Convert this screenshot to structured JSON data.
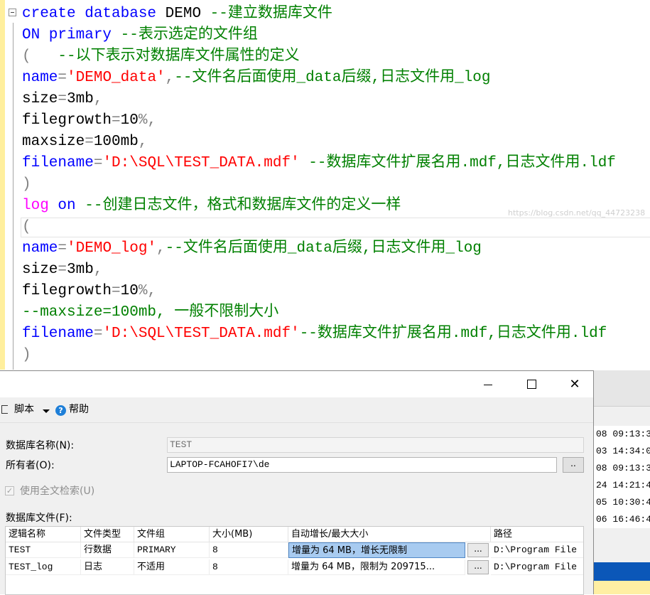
{
  "editor": {
    "lines": [
      [
        {
          "t": "create database ",
          "c": "kw"
        },
        {
          "t": "DEMO ",
          "c": "pl"
        },
        {
          "t": "--建立数据库文件",
          "c": "cm"
        }
      ],
      [
        {
          "t": "ON primary ",
          "c": "kw"
        },
        {
          "t": "--表示选定的文件组",
          "c": "cm"
        }
      ],
      [
        {
          "t": "(   ",
          "c": "op"
        },
        {
          "t": "--以下表示对数据库文件属性的定义",
          "c": "cm"
        }
      ],
      [
        {
          "t": "name",
          "c": "kw"
        },
        {
          "t": "=",
          "c": "op"
        },
        {
          "t": "'DEMO_data'",
          "c": "str"
        },
        {
          "t": ",",
          "c": "op"
        },
        {
          "t": "--文件名后面使用_data后缀,日志文件用_log",
          "c": "cm"
        }
      ],
      [
        {
          "t": "size",
          "c": "pl"
        },
        {
          "t": "=",
          "c": "op"
        },
        {
          "t": "3mb",
          "c": "pl"
        },
        {
          "t": ",",
          "c": "op"
        }
      ],
      [
        {
          "t": "filegrowth",
          "c": "pl"
        },
        {
          "t": "=",
          "c": "op"
        },
        {
          "t": "10",
          "c": "pl"
        },
        {
          "t": "%,",
          "c": "op"
        }
      ],
      [
        {
          "t": "maxsize",
          "c": "pl"
        },
        {
          "t": "=",
          "c": "op"
        },
        {
          "t": "100mb",
          "c": "pl"
        },
        {
          "t": ",",
          "c": "op"
        }
      ],
      [
        {
          "t": "filename",
          "c": "kw"
        },
        {
          "t": "=",
          "c": "op"
        },
        {
          "t": "'D:\\SQL\\TEST_DATA.mdf'",
          "c": "str"
        },
        {
          "t": " --数据库文件扩展名用.mdf,日志文件用.ldf",
          "c": "cm"
        }
      ],
      [
        {
          "t": ")",
          "c": "op"
        }
      ],
      [
        {
          "t": "log",
          "c": "mg"
        },
        {
          "t": " on ",
          "c": "kw"
        },
        {
          "t": "--创建日志文件，格式和数据库文件的定义一样",
          "c": "cm"
        }
      ],
      [
        {
          "t": "(",
          "c": "op"
        }
      ],
      [
        {
          "t": "name",
          "c": "kw"
        },
        {
          "t": "=",
          "c": "op"
        },
        {
          "t": "'DEMO_log'",
          "c": "str"
        },
        {
          "t": ",",
          "c": "op"
        },
        {
          "t": "--文件名后面使用_data后缀,日志文件用_log",
          "c": "cm"
        }
      ],
      [
        {
          "t": "size",
          "c": "pl"
        },
        {
          "t": "=",
          "c": "op"
        },
        {
          "t": "3mb",
          "c": "pl"
        },
        {
          "t": ",",
          "c": "op"
        }
      ],
      [
        {
          "t": "filegrowth",
          "c": "pl"
        },
        {
          "t": "=",
          "c": "op"
        },
        {
          "t": "10",
          "c": "pl"
        },
        {
          "t": "%,",
          "c": "op"
        }
      ],
      [
        {
          "t": "--maxsize=100mb, 一般不限制大小",
          "c": "cm"
        }
      ],
      [
        {
          "t": "filename",
          "c": "kw"
        },
        {
          "t": "=",
          "c": "op"
        },
        {
          "t": "'D:\\SQL\\TEST_DATA.mdf'",
          "c": "str"
        },
        {
          "t": "--数据库文件扩展名用.mdf,日志文件用.ldf",
          "c": "cm"
        }
      ],
      [
        {
          "t": ")",
          "c": "op"
        }
      ]
    ]
  },
  "results_grid": {
    "rows": [
      "08 09:13:3",
      "03 14:34:0",
      "08 09:13:3",
      "24 14:21:4",
      "05 10:30:4",
      "06 16:46:4"
    ]
  },
  "dialog": {
    "window_buttons": {
      "minimize": "—",
      "maximize": "☐",
      "close": "✕"
    },
    "toolbar": {
      "script": "脚本",
      "help": "帮助"
    },
    "db_name_label": "数据库名称(N):",
    "db_name_value": "TEST",
    "owner_label": "所有者(O):",
    "owner_value": "LAPTOP-FCAHOFI7\\de",
    "owner_browse": "..",
    "fulltext_label": "使用全文检索(U)",
    "files_label": "数据库文件(F):",
    "columns": [
      "逻辑名称",
      "文件类型",
      "文件组",
      "大小(MB)",
      "自动增长/最大大小",
      "路径"
    ],
    "rows": [
      {
        "logical": "TEST",
        "type": "行数据",
        "filegroup": "PRIMARY",
        "size": "8",
        "growth": "增量为 64 MB，增长无限制",
        "btn": "...",
        "path": "D:\\Program File"
      },
      {
        "logical": "TEST_log",
        "type": "日志",
        "filegroup": "不适用",
        "size": "8",
        "growth": "增量为 64 MB，限制为 209715...",
        "btn": "...",
        "path": "D:\\Program File"
      }
    ]
  },
  "watermark": "https://blog.csdn.net/qq_44723238"
}
